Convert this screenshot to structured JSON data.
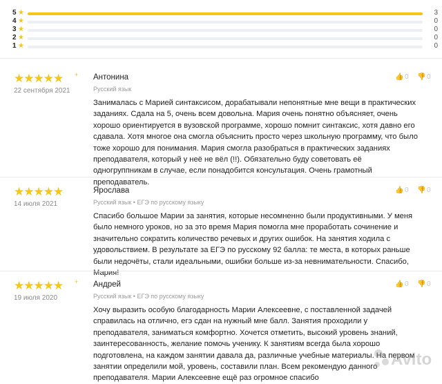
{
  "rating_distribution": [
    {
      "label": "5",
      "count": "3",
      "fraction": 1.0
    },
    {
      "label": "4",
      "count": "0",
      "fraction": 0
    },
    {
      "label": "3",
      "count": "0",
      "fraction": 0
    },
    {
      "label": "2",
      "count": "0",
      "fraction": 0
    },
    {
      "label": "1",
      "count": "0",
      "fraction": 0
    }
  ],
  "star_glyph": "★",
  "accent_color": "#f5c518",
  "reviews": [
    {
      "stars": "★★★★★",
      "rating_mark": "+",
      "date": "22 сентября 2021",
      "author": "Антонина",
      "subject": "Русский язык",
      "text": "Занималась с Марией синтаксисом, дорабатывали непонятные мне вещи в практических заданиях. Сдала на 5, очень всем довольна. Мария очень понятно объясняет, очень хорошо ориентируется в вузовской программе, хорошо помнит синтаксис, хотя давно его сдавала. Хотя многое она смогла объяснить просто через школьную программу, что было тоже хорошо для понимания. Мария смогла разобраться в практических заданиях преподавателя, который у неё не вёл (!!). Обязательно буду советовать её одногруппникам в случае, если понадобится консультация. Очень грамотный преподаватель.",
      "likes": "0",
      "dislikes": "0"
    },
    {
      "stars": "★★★★★",
      "rating_mark": "",
      "date": "14 июля 2021",
      "author": "Ярослава",
      "subject": "Русский язык • ЕГЭ по русскому языку",
      "text": "Спасибо большое Марии за занятия, которые несомненно были продуктивными. У меня было немного уроков, но за это время Мария помогла мне проработать сочинение и значительно сократить количество речевых и других ошибок. На занятия ходила с удовольствием. В результате за ЕГЭ по русскому 92 балла: те места, в которых раньше были недочёты, стали идеальными, ошибки больше из-за невнимательности. Спасибо, Мария!",
      "likes": "0",
      "dislikes": "0"
    },
    {
      "stars": "★★★★★",
      "rating_mark": "+",
      "date": "19 июля 2020",
      "author": "Андрей",
      "subject": "Русский язык • ЕГЭ по русскому языку",
      "text": "Хочу выразить особую благодарность Марии Алексеевне, с поставленной задачей справилась на отлично, егэ сдан на нужный мне балл. Занятия проходили у преподавателя, заниматься комфортно. Хочется отметить, высокий уровень знаний, заинтересованность, желание помочь ученику. К занятиям всегда была хорошо подготовлена, на каждом занятии давала да, различные учебные материалы. На первом занятии определили мой, уровень, составили план. Всем рекомендую данного преподавателя. Марии Алексеевне ещё раз огромное спасибо",
      "likes": "0",
      "dislikes": "0"
    }
  ],
  "watermark": "Avito"
}
